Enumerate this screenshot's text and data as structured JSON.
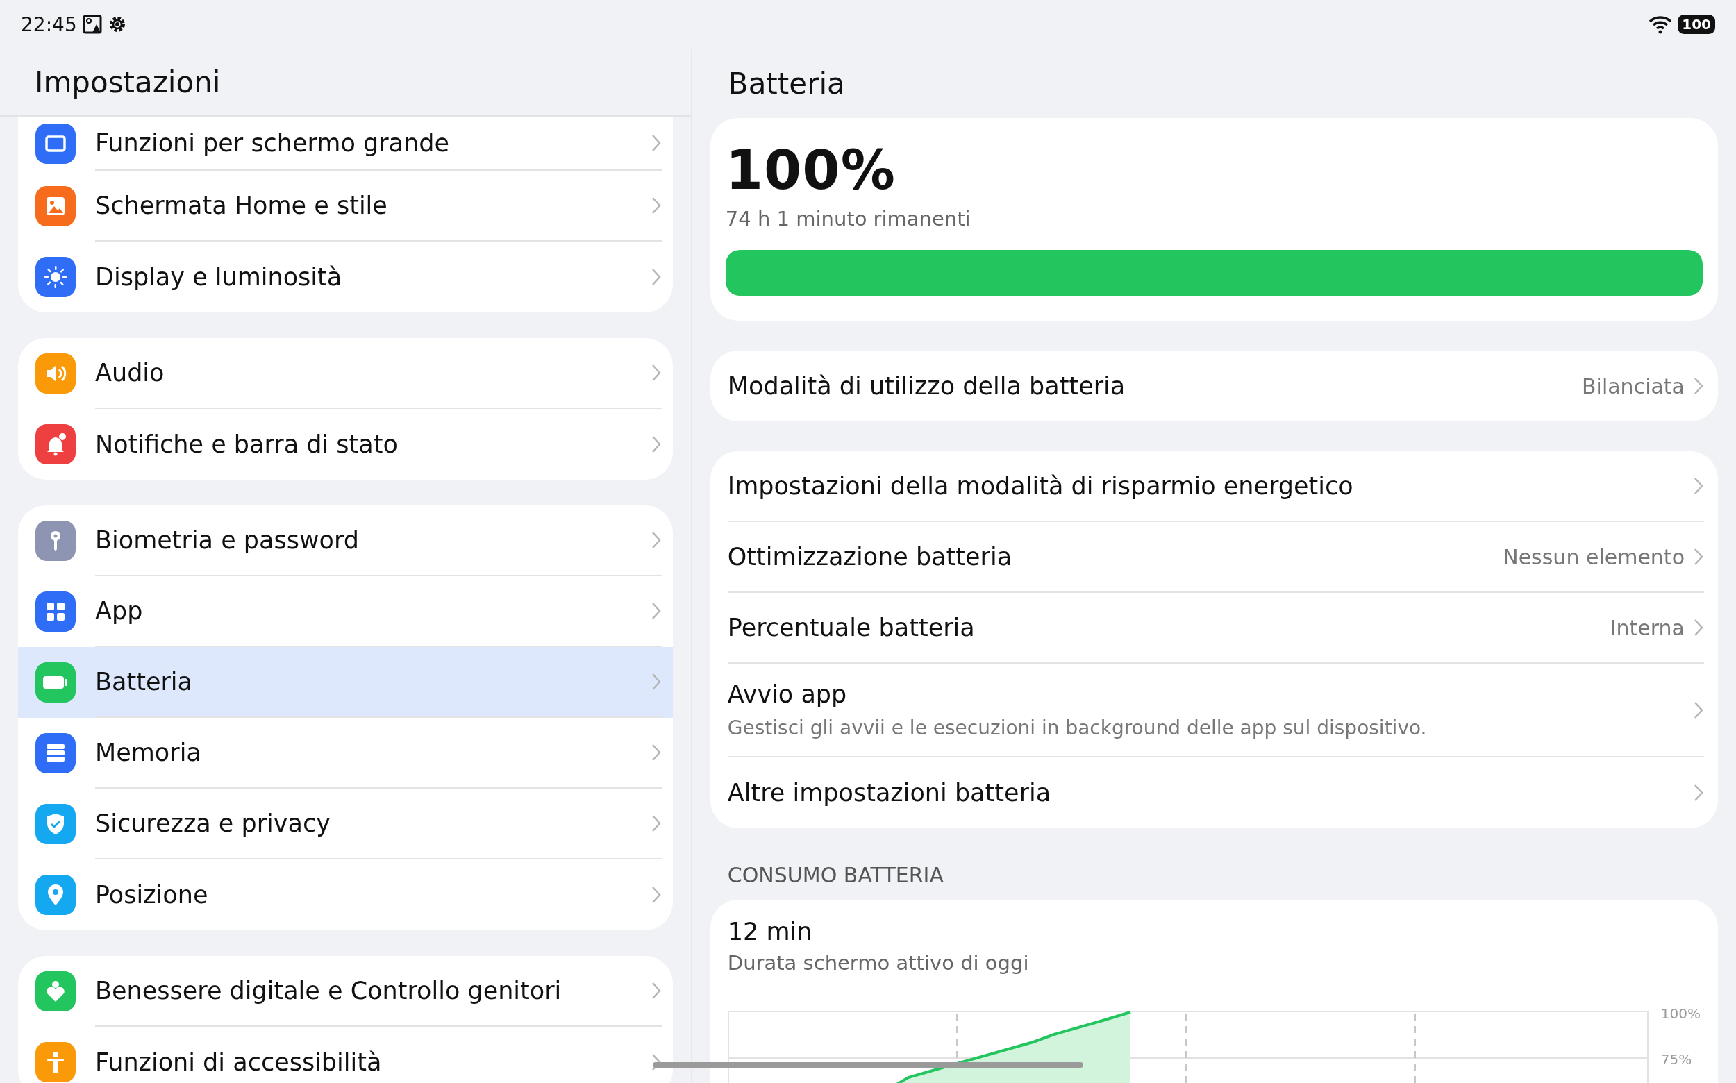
{
  "status_bar": {
    "time": "22:45",
    "battery": "100"
  },
  "sidebar": {
    "title": "Impostazioni",
    "groups": [
      {
        "items": [
          {
            "label": "Funzioni per schermo grande",
            "kind": "screen",
            "color": "#2f6df6",
            "selected": false
          },
          {
            "label": "Schermata Home e stile",
            "kind": "image",
            "color": "#f76b1c",
            "selected": false
          },
          {
            "label": "Display e luminosità",
            "kind": "sun",
            "color": "#2f6df6",
            "selected": false
          }
        ]
      },
      {
        "items": [
          {
            "label": "Audio",
            "kind": "speaker",
            "color": "#fb9a08",
            "selected": false
          },
          {
            "label": "Notifiche e barra di stato",
            "kind": "bell",
            "color": "#ee4040",
            "selected": false
          }
        ]
      },
      {
        "items": [
          {
            "label": "Biometria e password",
            "kind": "key",
            "color": "#8e95b3",
            "selected": false
          },
          {
            "label": "App",
            "kind": "grid",
            "color": "#2f6df6",
            "selected": false
          },
          {
            "label": "Batteria",
            "kind": "battery",
            "color": "#22c55e",
            "selected": true
          },
          {
            "label": "Memoria",
            "kind": "storage",
            "color": "#2f6df6",
            "selected": false
          },
          {
            "label": "Sicurezza e privacy",
            "kind": "shield",
            "color": "#13a8f0",
            "selected": false
          },
          {
            "label": "Posizione",
            "kind": "pin",
            "color": "#13a8f0",
            "selected": false
          }
        ]
      },
      {
        "items": [
          {
            "label": "Benessere digitale e Controllo genitori",
            "kind": "heart",
            "color": "#22c55e",
            "selected": false
          },
          {
            "label": "Funzioni di accessibilità",
            "kind": "person",
            "color": "#fb9a08",
            "selected": false
          }
        ]
      }
    ]
  },
  "detail": {
    "title": "Batteria",
    "battery": {
      "percent": "100%",
      "remaining": "74 h 1 minuto rimanenti",
      "level": 1.0
    },
    "groups": [
      {
        "items": [
          {
            "label": "Modalità di utilizzo della batteria",
            "value": "Bilanciata"
          }
        ]
      },
      {
        "items": [
          {
            "label": "Impostazioni della modalità di risparmio energetico"
          },
          {
            "label": "Ottimizzazione batteria",
            "value": "Nessun elemento"
          },
          {
            "label": "Percentuale batteria",
            "value": "Interna"
          },
          {
            "label": "Avvio app",
            "description": "Gestisci gli avvii e le esecuzioni in background delle app sul dispositivo."
          },
          {
            "label": "Altre impostazioni batteria"
          }
        ]
      }
    ],
    "usage": {
      "heading": "CONSUMO BATTERIA",
      "value": "12 min",
      "caption": "Durata schermo attivo di oggi",
      "y_labels": [
        "100%",
        "75%"
      ]
    }
  }
}
